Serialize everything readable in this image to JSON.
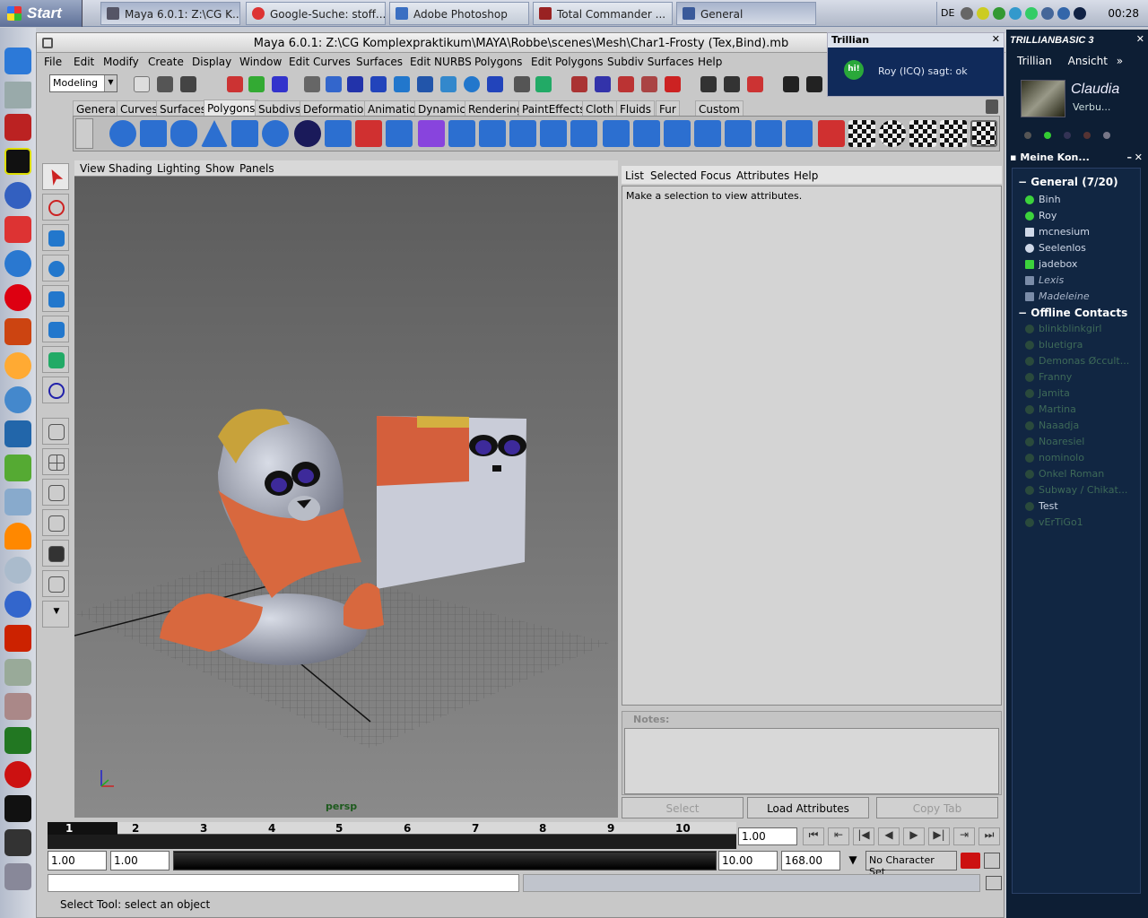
{
  "taskbar": {
    "start": "Start",
    "tasks": [
      "Maya 6.0.1: Z:\\CG K...",
      "Google-Suche: stoff...",
      "Adobe Photoshop",
      "Total Commander ...",
      "General"
    ],
    "lang": "DE",
    "clock": "00:28"
  },
  "maya": {
    "title": "Maya 6.0.1: Z:\\CG Komplexpraktikum\\MAYA\\Robbe\\scenes\\Mesh\\Char1-Frosty (Tex,Bind).mb",
    "menus": [
      "File",
      "Edit",
      "Modify",
      "Create",
      "Display",
      "Window",
      "Edit Curves",
      "Surfaces",
      "Edit NURBS",
      "Polygons",
      "Edit Polygons",
      "Subdiv Surfaces",
      "Help"
    ],
    "mode": "Modeling",
    "shelf_tabs": [
      "General",
      "Curves",
      "Surfaces",
      "Polygons",
      "Subdivs",
      "Deformation",
      "Animation",
      "Dynamics",
      "Rendering",
      "PaintEffects",
      "Cloth",
      "Fluids",
      "Fur",
      "Custom"
    ],
    "selected_shelf": "Polygons",
    "viewport_menus": [
      "View",
      "Shading",
      "Lighting",
      "Show",
      "Panels"
    ],
    "camera": "persp",
    "attr_menus": [
      "List",
      "Selected",
      "Focus",
      "Attributes",
      "Help"
    ],
    "attr_message": "Make a selection to view attributes.",
    "notes_label": "Notes:",
    "buttons": {
      "select": "Select",
      "load": "Load Attributes",
      "copy": "Copy Tab"
    },
    "timeline_numbers": [
      "1",
      "2",
      "3",
      "4",
      "5",
      "6",
      "7",
      "8",
      "9",
      "10"
    ],
    "current_frame": "1.00",
    "start_time": "1.00",
    "range_start": "1.00",
    "range_end": "10.00",
    "end_time": "168.00",
    "character_set": "No Character Set",
    "help_line": "Select Tool: select an object"
  },
  "trillian_popup": {
    "title": "Trillian",
    "badge": "hi!",
    "message": "Roy (ICQ) sagt: ok"
  },
  "trillian": {
    "logo": "TRILLIANBASIC 3",
    "menus": [
      "Trillian",
      "Ansicht"
    ],
    "user": "Claudia",
    "status": "Verbu...",
    "contacts_title": "Meine Kon...",
    "group_general": "General (7/20)",
    "online": [
      {
        "name": "Binh",
        "color": "#3cd23c"
      },
      {
        "name": "Roy",
        "color": "#3cd23c"
      },
      {
        "name": "mcnesium",
        "color": "#cfd8e8"
      },
      {
        "name": "Seelenlos",
        "color": "#cfd8e8"
      },
      {
        "name": "jadebox",
        "color": "#3cd23c"
      },
      {
        "name": "Lexis",
        "color": "#7a8ca8"
      },
      {
        "name": "Madeleine",
        "color": "#7a8ca8"
      }
    ],
    "group_offline": "Offline Contacts",
    "offline": [
      "blinkblinkgirl",
      "bluetigra",
      "Demonas Øccult...",
      "Franny",
      "Jamita",
      "Martina",
      "Naaadja",
      "Noaresiel",
      "nominolo",
      "Onkel Roman",
      "Subway / Chikat...",
      "Test",
      "vErTiGo1"
    ]
  },
  "colors": {
    "maya_bg": "#c8c8c8",
    "viewport": "#6c6c6c",
    "trillian_bg": "#0d1e34",
    "online": "#3cd23c"
  }
}
